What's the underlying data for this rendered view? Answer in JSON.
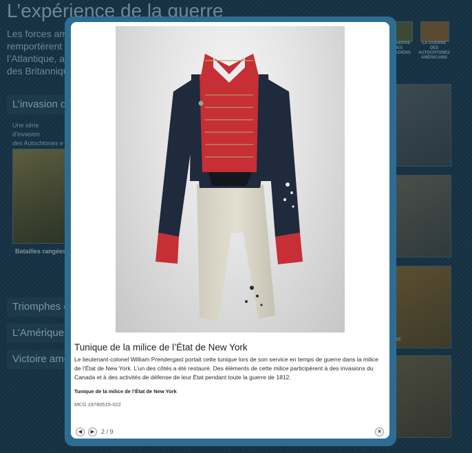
{
  "background": {
    "page_title": "L’expérience de la guerre",
    "intro": "Les forces amé... remportèrent... l’Atlantique, ai... des Britanniqu...",
    "intro_lines": [
      "Les forces amé",
      "remportèrent",
      "l’Atlantique, ai",
      "des Britanniqu"
    ],
    "sections": [
      {
        "label": "L’invasion du"
      },
      {
        "label": "Triomphes e"
      },
      {
        "label": "L’Amérique a"
      },
      {
        "label": "Victoire amé"
      }
    ],
    "section_desc_lines": [
      "Une série d’invasion",
      "des Autochtones e"
    ],
    "thumb_label": "Batailles rangées",
    "nav_labels": [
      {
        "lines": [
          "LA GUERRE",
          "DES",
          "CANADIENS"
        ]
      },
      {
        "lines": [
          "LA GUERRE",
          "DES",
          "AUTOCHTONES",
          "AMÉRICAINS"
        ]
      }
    ],
    "card_label": "URE"
  },
  "modal": {
    "image_alt": "Tunique de la milice de l’État de New York",
    "title": "Tunique de la milice de l’État de New York",
    "description": "Le lieutenant-colonel William Prendergast portait cette tunique lors de son service en temps de guerre dans la milice de l’État de New York. L’un des côtés a été restauré. Des éléments de cette milice participèrent à des invasions du Canada et à des activités de défense de leur État pendant toute la guerre de 1812.",
    "object_label": "Tunique de la milice de l’État de New York",
    "object_id": "MCG 19780515-022",
    "counter": "2 / 9",
    "prev_icon": "arrow-left-icon",
    "next_icon": "arrow-right-icon",
    "close_icon": "close-icon"
  },
  "colors": {
    "frame": "#2e6d93",
    "background": "#152d3d",
    "coat_red": "#c62f35",
    "coat_navy": "#1f2a3c",
    "trousers": "#d9d6c8"
  }
}
